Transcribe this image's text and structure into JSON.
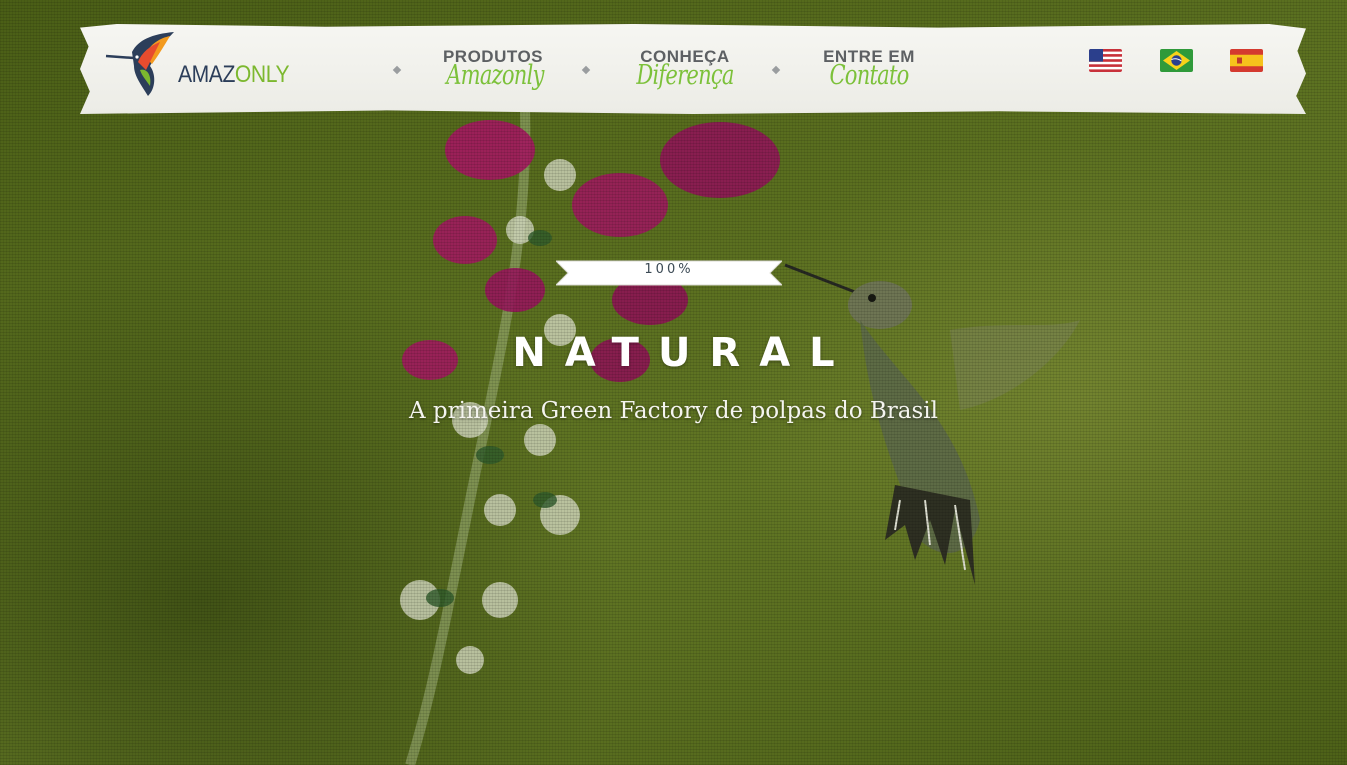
{
  "brand": {
    "name_part1": "AMAZ",
    "name_part2": "ONLY",
    "colors": {
      "navy": "#2c3e5a",
      "green": "#7cb82f",
      "orange": "#f39a1e"
    }
  },
  "nav": {
    "items": [
      {
        "top": "PRODUTOS",
        "bottom": "Amazonly"
      },
      {
        "top": "CONHEÇA",
        "bottom": "Diferença"
      },
      {
        "top": "ENTRE EM",
        "bottom": "Contato"
      }
    ],
    "separator_icon": "diamond-bullet"
  },
  "languages": [
    {
      "code": "en",
      "icon": "us-flag-icon"
    },
    {
      "code": "pt",
      "icon": "brazil-flag-icon"
    },
    {
      "code": "es",
      "icon": "spain-flag-icon"
    }
  ],
  "hero": {
    "badge": "100%",
    "title": "NATURAL",
    "subtitle": "A primeira Green Factory de polpas do Brasil"
  },
  "theme": {
    "accent_green": "#7cc13a",
    "nav_gray": "#5d6063",
    "background_green": "#566b1c"
  }
}
